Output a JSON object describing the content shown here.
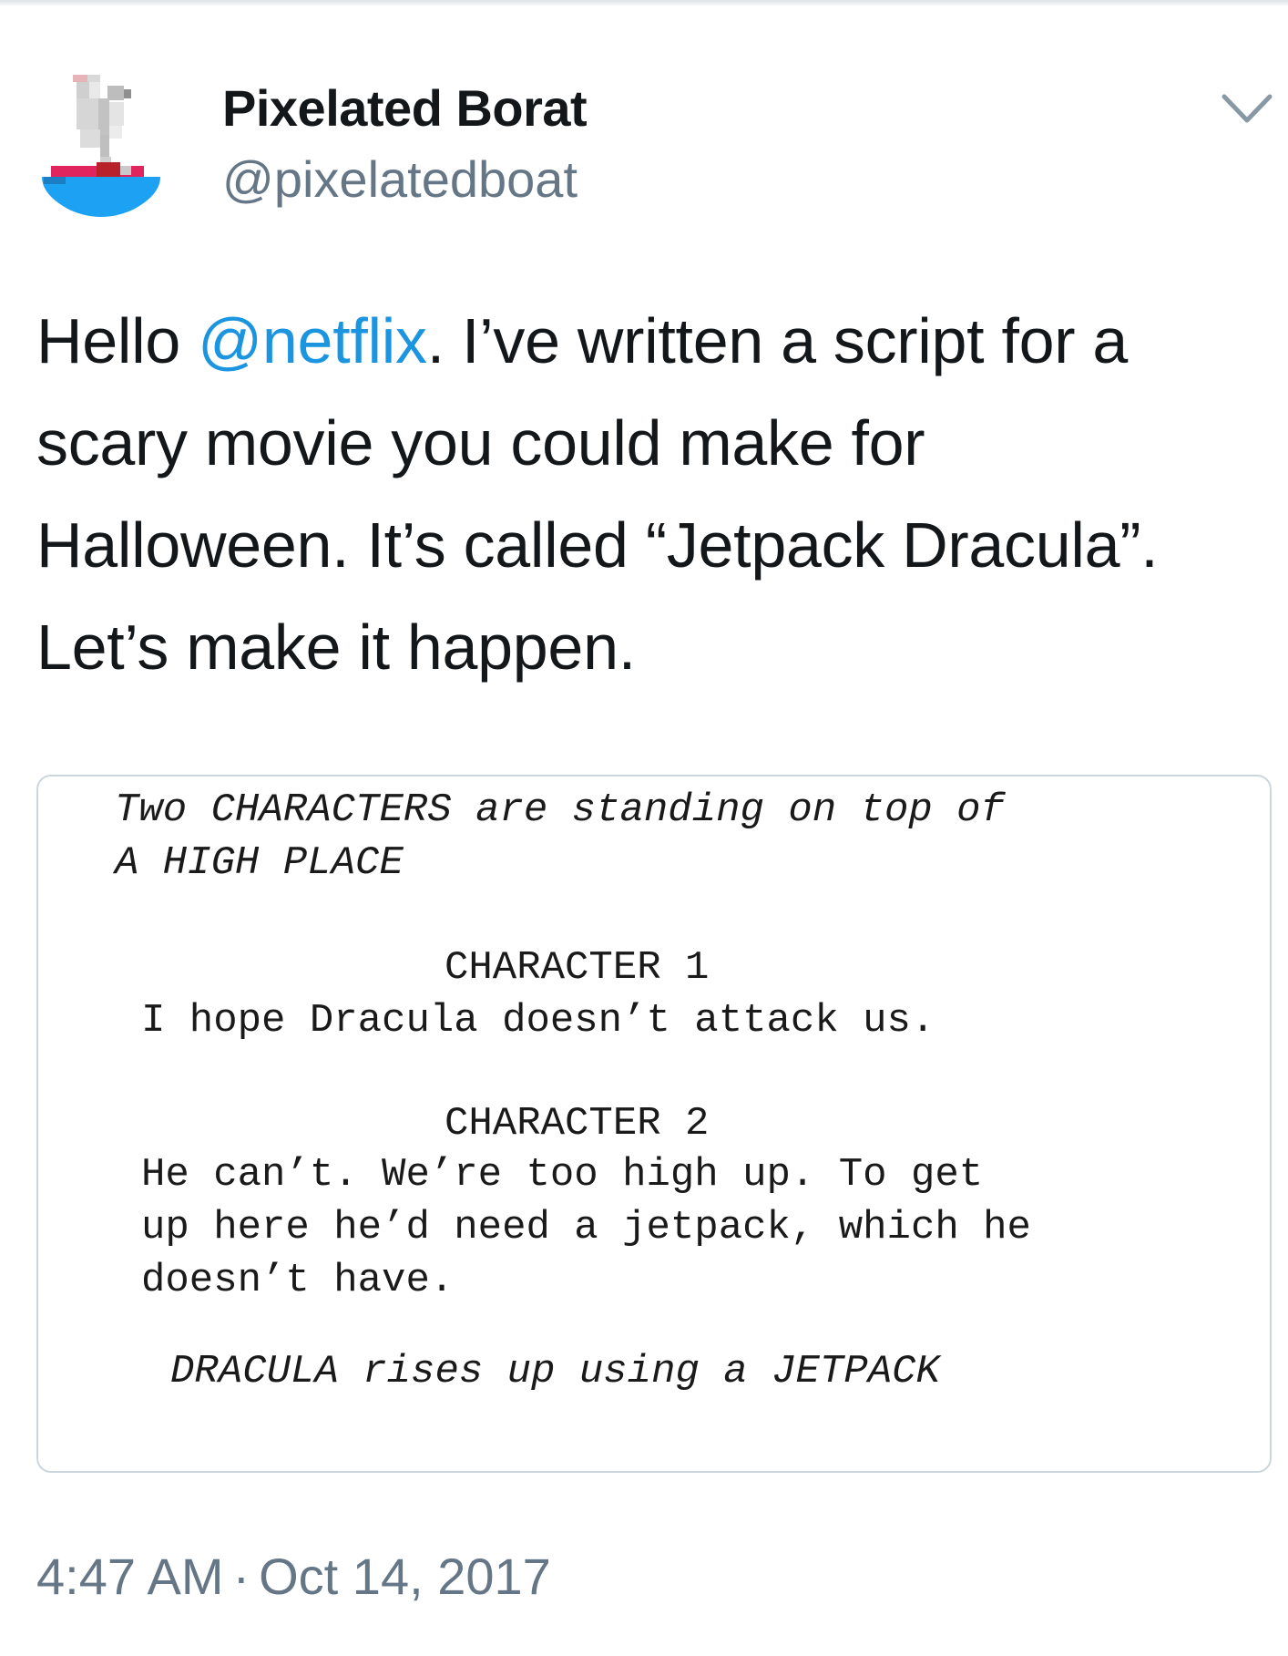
{
  "author": {
    "name": "Pixelated Borat",
    "handle": "@pixelatedboat"
  },
  "menu_icon": "chevron-down-icon",
  "tweet": {
    "line1_before": "Hello ",
    "mention": "@netflix",
    "line1_after": ". I’ve written a script for a",
    "line2": "scary movie you could make for",
    "line3": "Halloween. It’s called “Jetpack Dracula”.",
    "line4": "Let’s make it happen."
  },
  "script_image": {
    "action_1": [
      "Two CHARACTERS are standing on top of",
      "A HIGH PLACE"
    ],
    "character_1": "CHARACTER 1",
    "dialog_1": "I hope Dracula doesn’t attack us.",
    "character_2": "CHARACTER 2",
    "dialog_2": [
      "He can’t. We’re too high up. To get",
      "up here he’d need a jetpack, which he",
      "doesn’t have."
    ],
    "action_2": "DRACULA rises up using a JETPACK"
  },
  "meta": {
    "time": "4:47 AM",
    "separator": "·",
    "date": "Oct 14, 2017"
  },
  "colors": {
    "link": "#1b95e0",
    "secondary_text": "#657786",
    "primary_text": "#14171a",
    "card_border": "#ccd6dd",
    "avatar_sea": "#1da1f2",
    "avatar_hull": "#e0245e"
  }
}
